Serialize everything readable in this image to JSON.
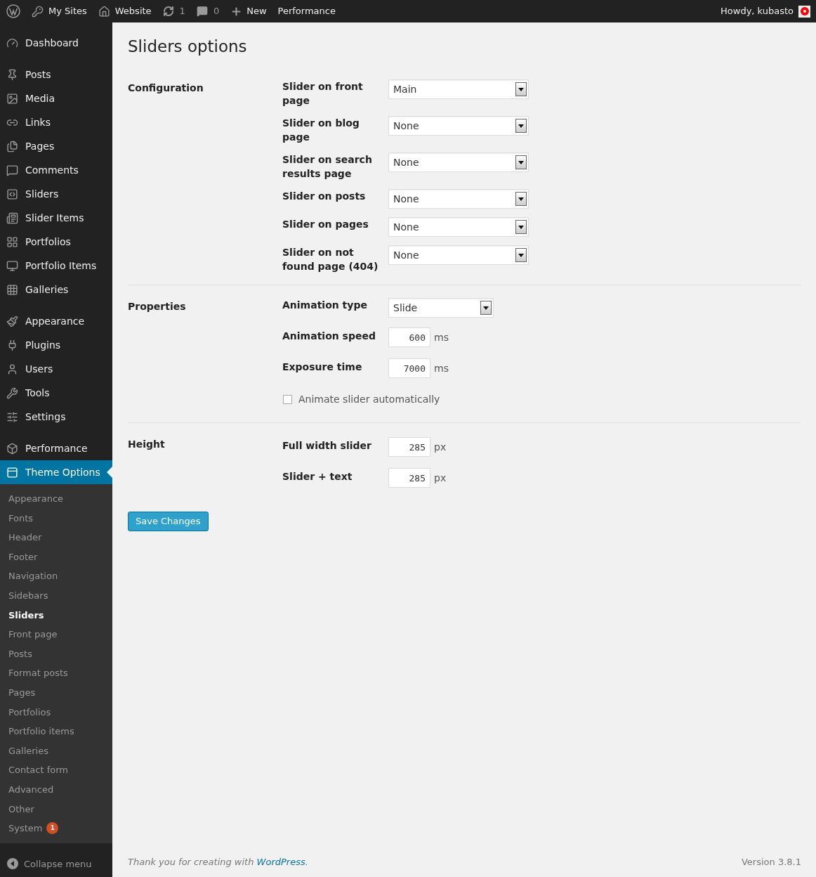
{
  "admin_bar": {
    "left": [
      {
        "kind": "logo"
      },
      {
        "kind": "link",
        "label": "My Sites"
      },
      {
        "kind": "link",
        "label": "Website"
      },
      {
        "kind": "updates",
        "label": "1"
      },
      {
        "kind": "comments",
        "label": "0"
      },
      {
        "kind": "new",
        "label": "New"
      },
      {
        "kind": "plain",
        "label": "Performance"
      }
    ],
    "greeting": "Howdy, kubasto"
  },
  "sidebar": {
    "groups": [
      [
        {
          "label": "Dashboard",
          "selected": false
        }
      ],
      [
        {
          "label": "Posts",
          "selected": false
        },
        {
          "label": "Media",
          "selected": false
        },
        {
          "label": "Links",
          "selected": false
        },
        {
          "label": "Pages",
          "selected": false
        },
        {
          "label": "Comments",
          "selected": false
        },
        {
          "label": "Sliders",
          "selected": false
        },
        {
          "label": "Slider Items",
          "selected": false
        },
        {
          "label": "Portfolios",
          "selected": false
        },
        {
          "label": "Portfolio Items",
          "selected": false
        },
        {
          "label": "Galleries",
          "selected": false
        }
      ],
      [
        {
          "label": "Appearance",
          "selected": false
        },
        {
          "label": "Plugins",
          "selected": false
        },
        {
          "label": "Users",
          "selected": false
        },
        {
          "label": "Tools",
          "selected": false
        },
        {
          "label": "Settings",
          "selected": false
        }
      ],
      [
        {
          "label": "Performance",
          "selected": false
        },
        {
          "label": "Theme Options",
          "selected": true
        }
      ]
    ],
    "submenu": [
      {
        "label": "Appearance",
        "selected": false
      },
      {
        "label": "Fonts",
        "selected": false
      },
      {
        "label": "Header",
        "selected": false
      },
      {
        "label": "Footer",
        "selected": false
      },
      {
        "label": "Navigation",
        "selected": false
      },
      {
        "label": "Sidebars",
        "selected": false
      },
      {
        "label": "Sliders",
        "selected": true
      },
      {
        "label": "Front page",
        "selected": false
      },
      {
        "label": "Posts",
        "selected": false
      },
      {
        "label": "Format posts",
        "selected": false
      },
      {
        "label": "Pages",
        "selected": false
      },
      {
        "label": "Portfolios",
        "selected": false
      },
      {
        "label": "Portfolio items",
        "selected": false
      },
      {
        "label": "Galleries",
        "selected": false
      },
      {
        "label": "Contact form",
        "selected": false
      },
      {
        "label": "Advanced",
        "selected": false
      },
      {
        "label": "Other",
        "selected": false
      },
      {
        "label": "System",
        "selected": false,
        "badge": "1"
      }
    ],
    "collapse": "Collapse menu"
  },
  "page": {
    "title": "Sliders options",
    "sections": [
      {
        "label": "Configuration",
        "fields": [
          {
            "kind": "select",
            "label": "Slider on front page",
            "value": "Main"
          },
          {
            "kind": "select",
            "label": "Slider on blog page",
            "value": "None"
          },
          {
            "kind": "select",
            "label": "Slider on search results page",
            "value": "None"
          },
          {
            "kind": "select",
            "label": "Slider on posts",
            "value": "None"
          },
          {
            "kind": "select",
            "label": "Slider on pages",
            "value": "None"
          },
          {
            "kind": "select",
            "label": "Slider on not found page (404)",
            "value": "None"
          }
        ]
      },
      {
        "label": "Properties",
        "fields": [
          {
            "kind": "select",
            "label": "Animation type",
            "value": "Slide"
          },
          {
            "kind": "number",
            "label": "Animation speed",
            "value": "600",
            "unit": "ms"
          },
          {
            "kind": "number",
            "label": "Exposure time",
            "value": "7000",
            "unit": "ms"
          },
          {
            "kind": "checkbox",
            "label": "Animate slider automatically",
            "checked": false
          }
        ]
      },
      {
        "label": "Height",
        "fields": [
          {
            "kind": "number",
            "label": "Full width slider",
            "value": "285",
            "unit": "px"
          },
          {
            "kind": "number",
            "label": "Slider + text",
            "value": "285",
            "unit": "px"
          }
        ]
      }
    ],
    "save": "Save Changes"
  },
  "footer": {
    "thanks": "Thank you for creating with ",
    "link": "WordPress",
    "end": ".",
    "version": "Version 3.8.1"
  }
}
